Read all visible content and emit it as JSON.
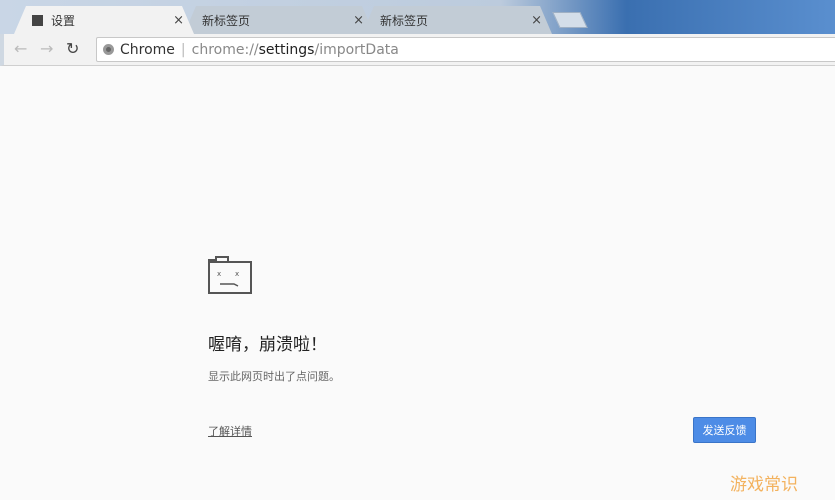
{
  "tabs": [
    {
      "label": "设置",
      "icon": "settings-page-icon",
      "active": true
    },
    {
      "label": "新标签页",
      "active": false
    },
    {
      "label": "新标签页",
      "active": false
    }
  ],
  "tab_close_glyph": "×",
  "omnibox": {
    "chip_label": "Chrome",
    "url_scheme": "chrome://",
    "url_host": "settings",
    "url_path": "/importData"
  },
  "error": {
    "title": "喔唷，崩溃啦！",
    "description": "显示此网页时出了点问题。",
    "learn_more": "了解详情",
    "feedback_button": "发送反馈"
  },
  "watermark": "游戏常识",
  "colors": {
    "button": "#4d8ce6",
    "watermark": "#f3b25e"
  }
}
